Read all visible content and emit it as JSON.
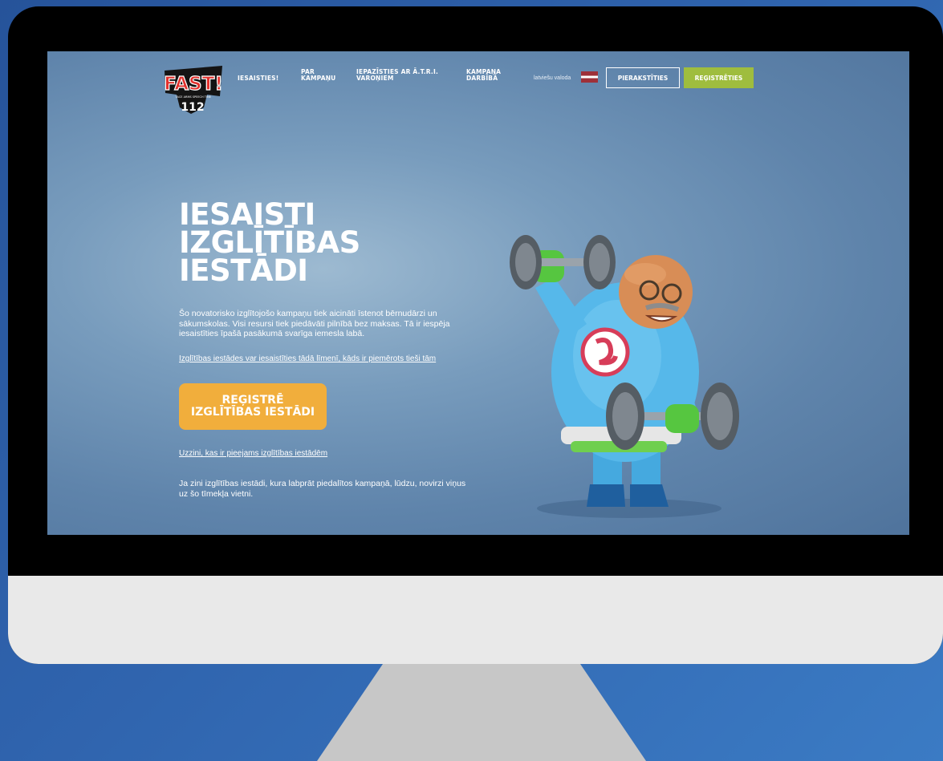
{
  "logo": {
    "brand": "FAST!",
    "tagline": "FACE ARMS SPEECH TIME",
    "number": "112"
  },
  "nav": {
    "items": [
      {
        "label": "IESAISTIES!"
      },
      {
        "label": "PAR\nKAMPAŅU"
      },
      {
        "label": "IEPAZĪSTIES AR Ā.T.R.I.\nVAROŅIEM"
      },
      {
        "label": "KAMPAŅA\nDARBĪBĀ"
      }
    ],
    "language": "latviešu valoda",
    "login": "PIERAKSTĪTIES",
    "register": "REĢISTRĒTIES"
  },
  "hero": {
    "title": "IESAISTI\nIZGLĪTĪBAS\nIESTĀDI",
    "description": "Šo novatorisko izglītojošo kampaņu tiek aicināti īstenot bērnudārzi un sākumskolas. Visi resursi tiek piedāvāti pilnībā bez maksas. Tā ir iespēja iesaistīties īpašā pasākumā svarīga iemesla labā.",
    "level_link": "Izglītības iestādes var iesaistīties tādā līmenī, kāds ir piemērots tieši tām",
    "cta": "REĢISTRĒ\nIZGLĪTĪBAS IESTĀDI",
    "available_link": "Uzzini, kas ir pieejams izglītības iestādēm",
    "footer": "Ja zini izglītības iestādi, kura labprāt piedalītos kampaņā, lūdzu, novirzi viņus uz šo tīmekļa vietni."
  },
  "colors": {
    "cta": "#f1ae3c",
    "register_button": "#9fbd3e",
    "background": "#2f63ad"
  }
}
